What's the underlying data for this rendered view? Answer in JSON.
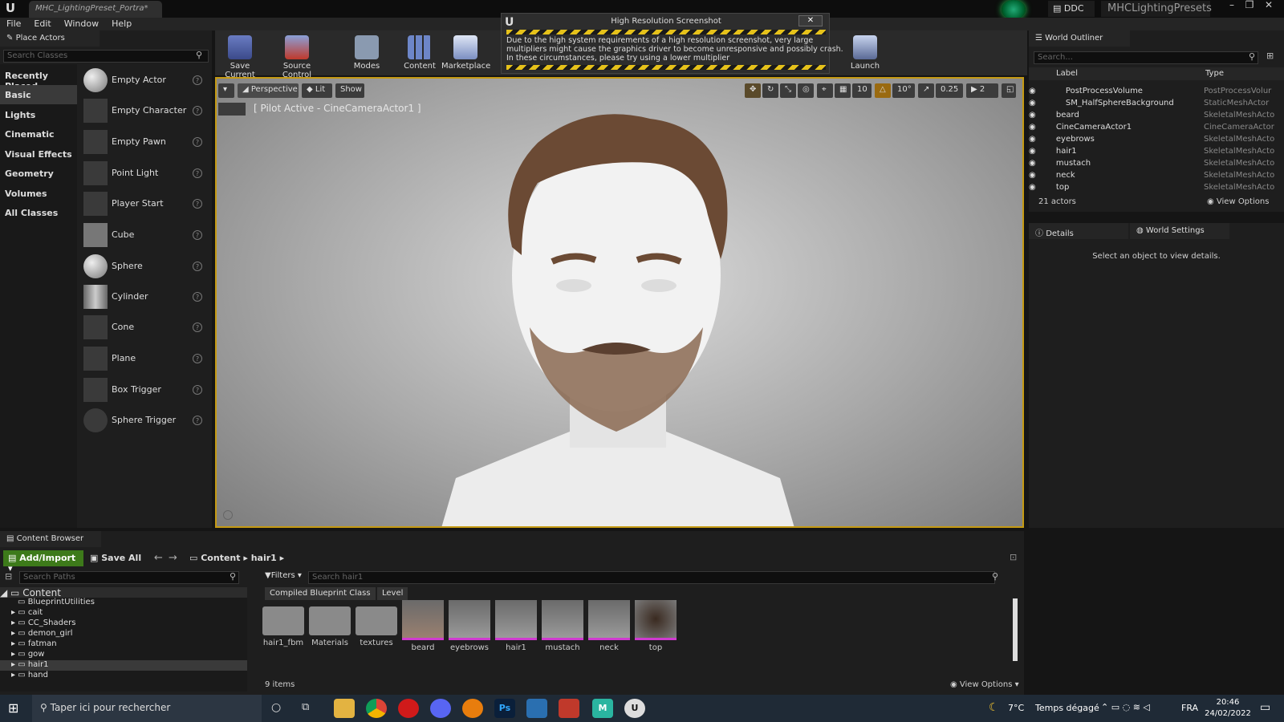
{
  "window": {
    "tab_title": "MHC_LightingPreset_Portra*",
    "ddc": "DDC",
    "project": "MHCLightingPresets"
  },
  "menu": [
    "File",
    "Edit",
    "Window",
    "Help"
  ],
  "place_actors": {
    "tab": "Place Actors",
    "search_placeholder": "Search Classes",
    "categories": [
      "Recently Placed",
      "Basic",
      "Lights",
      "Cinematic",
      "Visual Effects",
      "Geometry",
      "Volumes",
      "All Classes"
    ],
    "items": [
      "Empty Actor",
      "Empty Character",
      "Empty Pawn",
      "Point Light",
      "Player Start",
      "Cube",
      "Sphere",
      "Cylinder",
      "Cone",
      "Plane",
      "Box Trigger",
      "Sphere Trigger"
    ]
  },
  "toolbar": {
    "save": "Save Current",
    "source": "Source Control",
    "modes": "Modes",
    "content": "Content",
    "marketplace": "Marketplace",
    "launch": "Launch"
  },
  "dialog": {
    "title": "High Resolution Screenshot",
    "line1": "Due to the high system requirements of a high resolution screenshot, very large",
    "line2": "multipliers might cause the graphics driver to become unresponsive and possibly crash.",
    "line3": "In these circumstances, please try using a lower multiplier"
  },
  "viewport": {
    "perspective": "Perspective",
    "lit": "Lit",
    "show": "Show",
    "pilot": "[ Pilot Active - CineCameraActor1 ]",
    "grid": "10",
    "angle": "10°",
    "scale": "0.25",
    "cam_speed": "2"
  },
  "outliner": {
    "tab": "World Outliner",
    "search_placeholder": "Search...",
    "col_label": "Label",
    "col_type": "Type",
    "rows": [
      {
        "label": "PostProcessVolume",
        "type": "PostProcessVolur"
      },
      {
        "label": "SM_HalfSphereBackground",
        "type": "StaticMeshActor"
      },
      {
        "label": "beard",
        "type": "SkeletalMeshActo"
      },
      {
        "label": "CineCameraActor1",
        "type": "CineCameraActor"
      },
      {
        "label": "eyebrows",
        "type": "SkeletalMeshActo"
      },
      {
        "label": "hair1",
        "type": "SkeletalMeshActo"
      },
      {
        "label": "mustach",
        "type": "SkeletalMeshActo"
      },
      {
        "label": "neck",
        "type": "SkeletalMeshActo"
      },
      {
        "label": "top",
        "type": "SkeletalMeshActo"
      }
    ],
    "count": "21 actors",
    "view_options": "View Options"
  },
  "details": {
    "tab1": "Details",
    "tab2": "World Settings",
    "empty": "Select an object to view details."
  },
  "content_browser": {
    "tab": "Content Browser",
    "add_import": "Add/Import",
    "save_all": "Save All",
    "crumb1": "Content",
    "crumb2": "hair1",
    "search_paths": "Search Paths",
    "filters": "Filters",
    "search_placeholder": "Search hair1",
    "filter_chips": [
      "Compiled Blueprint Class",
      "Level"
    ],
    "tree_root": "Content",
    "tree": [
      "BlueprintUtilities",
      "cait",
      "CC_Shaders",
      "demon_girl",
      "fatman",
      "gow",
      "hair1",
      "hand"
    ],
    "assets": [
      "hair1_fbm",
      "Materials",
      "textures",
      "beard",
      "eyebrows",
      "hair1",
      "mustach",
      "neck",
      "top"
    ],
    "count": "9 items",
    "view_options": "View Options"
  },
  "taskbar": {
    "search": "Taper ici pour rechercher",
    "temp": "7°C",
    "weather": "Temps dégagé",
    "lang": "FRA",
    "time": "20:46",
    "date": "24/02/2022"
  }
}
